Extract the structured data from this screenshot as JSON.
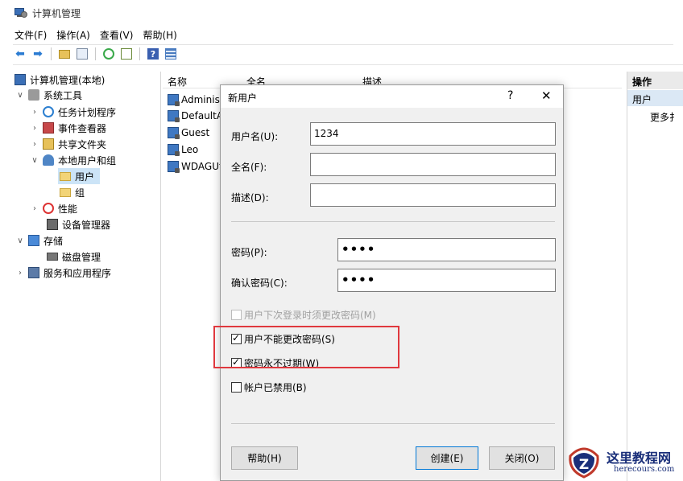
{
  "window": {
    "title": "计算机管理"
  },
  "menu": [
    "文件(F)",
    "操作(A)",
    "查看(V)",
    "帮助(H)"
  ],
  "toolbar": {
    "icons": [
      "back-icon",
      "forward-icon",
      "up-folder-icon",
      "console-tree-icon",
      "refresh-icon",
      "export-icon",
      "help-icon",
      "view-icon"
    ]
  },
  "tree": {
    "root": "计算机管理(本地)",
    "system_tools": "系统工具",
    "task_scheduler": "任务计划程序",
    "event_viewer": "事件查看器",
    "shared_folders": "共享文件夹",
    "local_users": "本地用户和组",
    "users": "用户",
    "groups": "组",
    "performance": "性能",
    "device_manager": "设备管理器",
    "storage": "存储",
    "disk_management": "磁盘管理",
    "services": "服务和应用程序"
  },
  "list": {
    "columns": [
      "名称",
      "全名",
      "描述"
    ],
    "rows": [
      "Administ",
      "DefaultA",
      "Guest",
      "Leo",
      "WDAGUt"
    ]
  },
  "actions": {
    "header": "操作",
    "section": "用户",
    "more": "更多扌"
  },
  "dialog": {
    "title": "新用户",
    "help_glyph": "?",
    "close_glyph": "✕",
    "username_label": "用户名(U):",
    "username_value": "1234",
    "fullname_label": "全名(F):",
    "fullname_value": "",
    "desc_label": "描述(D):",
    "desc_value": "",
    "password_label": "密码(P):",
    "password_value": "••••",
    "confirm_label": "确认密码(C):",
    "confirm_value": "••••",
    "cb_must_change": "用户下次登录时须更改密码(M)",
    "cb_cannot_change": "用户不能更改密码(S)",
    "cb_never_expires": "密码永不过期(W)",
    "cb_disabled": "帐户已禁用(B)",
    "btn_help": "帮助(H)",
    "btn_create": "创建(E)",
    "btn_close": "关闭(O)",
    "checkbox_state": {
      "must_change": false,
      "cannot_change": true,
      "never_expires": true,
      "disabled": false
    }
  },
  "annotation": {
    "highlight_color": "#e0383e"
  },
  "watermark": {
    "cn": "这里教程网",
    "en": "herecours.com"
  }
}
